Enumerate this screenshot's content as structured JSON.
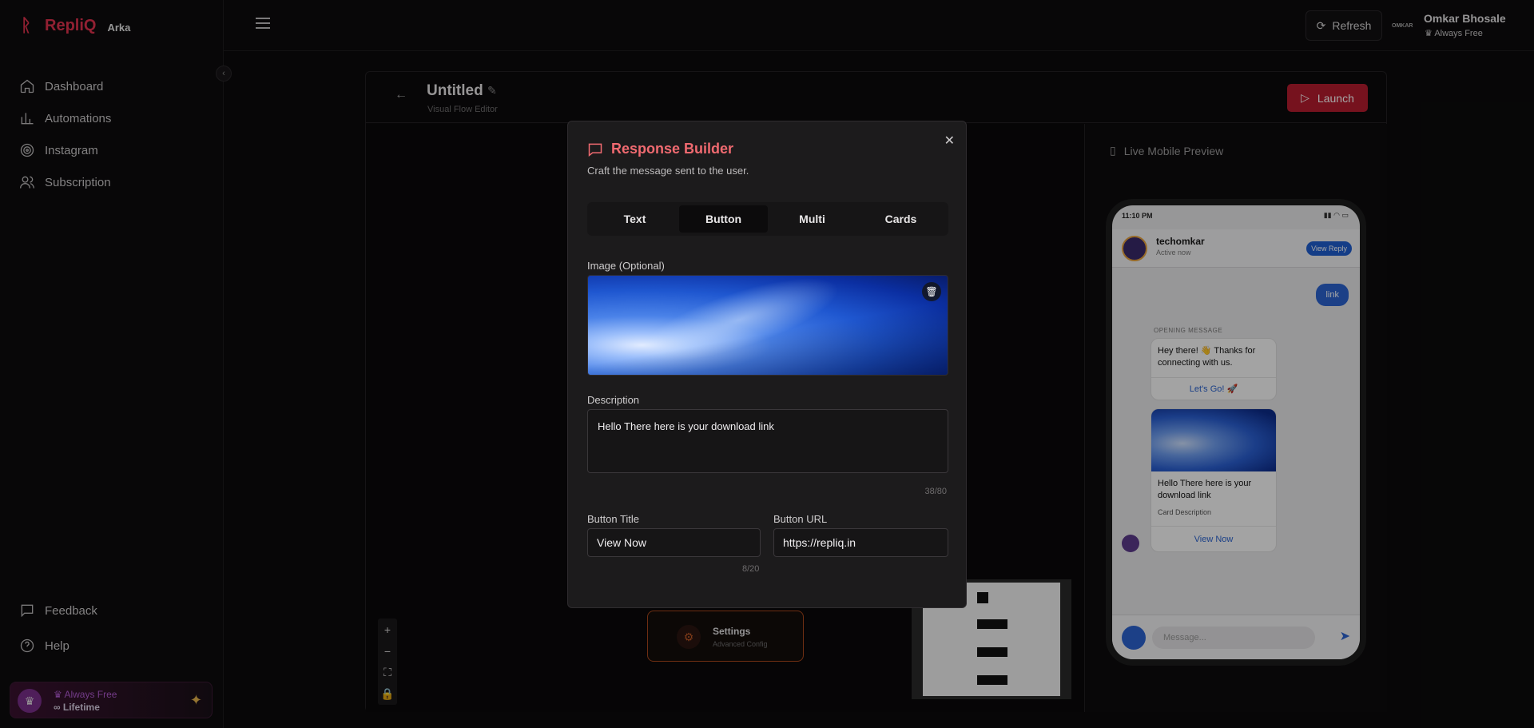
{
  "brand": {
    "name": "RepliQ",
    "sub": "Arka"
  },
  "sidebar": {
    "items": [
      {
        "label": "Dashboard",
        "icon": "home-icon"
      },
      {
        "label": "Automations",
        "icon": "chart-icon"
      },
      {
        "label": "Instagram",
        "icon": "target-icon"
      },
      {
        "label": "Subscription",
        "icon": "users-icon"
      }
    ],
    "bottom": [
      {
        "label": "Feedback",
        "icon": "chat-icon"
      },
      {
        "label": "Help",
        "icon": "help-icon"
      }
    ],
    "plan": {
      "title": "Always Free",
      "sub": "Lifetime"
    }
  },
  "topbar": {
    "refresh_label": "Refresh",
    "avatar_text": "OMKAR",
    "user_name": "Omkar Bhosale",
    "user_plan": "Always Free"
  },
  "editor": {
    "title": "Untitled",
    "subtitle": "Visual Flow Editor",
    "launch_label": "Launch"
  },
  "canvas": {
    "settings_title": "Settings",
    "settings_sub": "Advanced Config",
    "zoom": [
      "+",
      "−",
      "⛶",
      "🔒"
    ]
  },
  "preview": {
    "label": "Live Mobile Preview",
    "time": "11:10 PM",
    "contact_name": "techomkar",
    "contact_status": "Active now",
    "view_reply": "View Reply",
    "outgoing": "link",
    "opening_label": "OPENING MESSAGE",
    "opening_text": "Hey there! 👋 Thanks for connecting with us.",
    "opening_button": "Let's Go! 🚀",
    "card_title": "Hello There here is your download link",
    "card_desc": "Card Description",
    "card_button": "View Now",
    "message_placeholder": "Message..."
  },
  "modal": {
    "title": "Response Builder",
    "subtitle": "Craft the message sent to the user.",
    "tabs": [
      "Text",
      "Button",
      "Multi",
      "Cards"
    ],
    "active_tab": "Button",
    "image_label": "Image (Optional)",
    "description_label": "Description",
    "description_value": "Hello There here is your download link",
    "description_counter": "38/80",
    "button_title_label": "Button Title",
    "button_title_value": "View Now",
    "button_title_counter": "8/20",
    "button_url_label": "Button URL",
    "button_url_value": "https://repliq.in"
  },
  "colors": {
    "accent": "#e0324d",
    "launch": "#b51c2e",
    "modal_title": "#f06a70",
    "preview_blue": "#2b63cf"
  }
}
